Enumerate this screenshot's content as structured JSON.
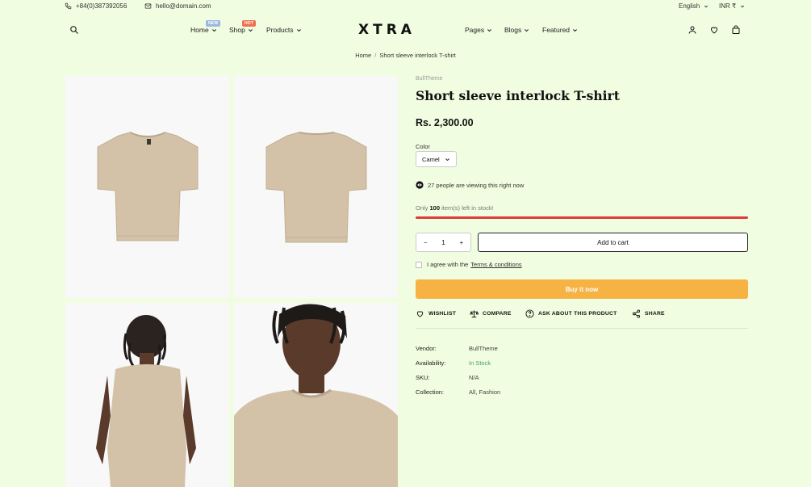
{
  "topbar": {
    "phone": "+84(0)387392056",
    "email": "hello@domain.com",
    "language": "English",
    "currency": "INR ₹"
  },
  "nav": {
    "left": [
      {
        "label": "Home",
        "badge": "NEW",
        "badge_color": "#9bb8de"
      },
      {
        "label": "Shop",
        "badge": "HOT",
        "badge_color": "#f07050"
      },
      {
        "label": "Products"
      }
    ],
    "logo": "XTRA",
    "right": [
      {
        "label": "Pages"
      },
      {
        "label": "Blogs"
      },
      {
        "label": "Featured"
      }
    ]
  },
  "breadcrumb": {
    "home": "Home",
    "separator": "/",
    "current": "Short sleeve interlock T-shirt"
  },
  "product": {
    "vendor_top": "BullTheme",
    "title": "Short sleeve interlock T-shirt",
    "price": "Rs. 2,300.00",
    "color_label": "Color",
    "color_value": "Camel",
    "viewing": "27 people are viewing this right now",
    "stock_prefix": "Only",
    "stock_count": "100",
    "stock_suffix": "item(s) left in stock!",
    "stock_fraction": 1.0,
    "quantity": "1",
    "qty_minus": "−",
    "qty_plus": "+",
    "add_to_cart": "Add to cart",
    "agree_text": "I agree with the",
    "terms_link": "Terms & conditions",
    "buy_now": "Buy it now",
    "accent_color": "#f7b244"
  },
  "actions": {
    "wishlist": "WISHLIST",
    "compare": "COMPARE",
    "ask": "ASK ABOUT THIS PRODUCT",
    "share": "SHARE"
  },
  "meta": [
    {
      "key": "Vendor:",
      "value": "BullTheme"
    },
    {
      "key": "Availability:",
      "value": "In Stock"
    },
    {
      "key": "SKU:",
      "value": "N/A"
    },
    {
      "key": "Collection:",
      "value": "All, Fashion"
    }
  ]
}
